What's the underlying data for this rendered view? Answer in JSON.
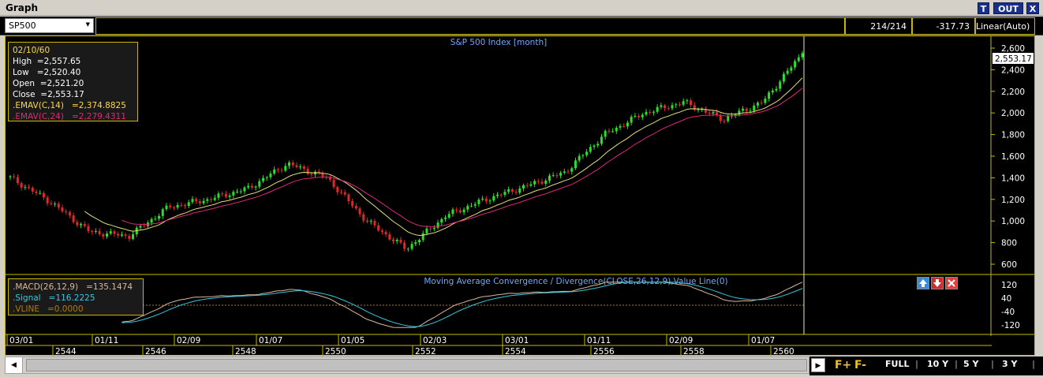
{
  "window": {
    "title": "Graph",
    "btn_t": "T",
    "btn_out": "OUT",
    "btn_x": "X"
  },
  "toolbar": {
    "symbol": "SP500",
    "bar_count": "214/214",
    "price_readout": "-317.73",
    "scale": "Linear(Auto)"
  },
  "main_chart": {
    "title": "S&P 500 Index [month]",
    "info": {
      "date": "02/10/60",
      "high": "High  =2,557.65",
      "low": "Low   =2,520.40",
      "open": "Open  =2,521.20",
      "close": "Close  =2,553.17",
      "emav14": ".EMAV(C,14)   =2,374.8825",
      "emav24": ".EMAV(C,24)   =2,279.4311"
    },
    "current_price": "2,553.17",
    "y_ticks": [
      "2,600",
      "2,400",
      "2,200",
      "2,000",
      "1,800",
      "1,600",
      "1,400",
      "1,200",
      "1,000",
      "800",
      "600"
    ]
  },
  "macd_chart": {
    "title": "Moving Average Convergence / Divergence(CLOSE,26,12,9),Value Line(0)",
    "info": {
      "macd": ".MACD(26,12,9)   =135.1474",
      "signal": ".Signal   =116.2225",
      "vline": ".VLINE   =0.0000"
    },
    "y_ticks": [
      "120",
      "40",
      "-40",
      "-120"
    ]
  },
  "x_axis": {
    "months": [
      "03/01",
      "01/11",
      "02/09",
      "01/07",
      "01/05",
      "02/03",
      "03/01",
      "01/11",
      "02/09",
      "01/07"
    ],
    "years": [
      "2544",
      "2546",
      "2548",
      "2550",
      "2552",
      "2554",
      "2556",
      "2558",
      "2560"
    ]
  },
  "bottom_bar": {
    "f_plus": "F+",
    "f_minus": "F-",
    "full": "FULL",
    "y10": "10 Y",
    "y5": "5 Y",
    "y3": "3 Y"
  },
  "chart_data": {
    "type": "candlestick",
    "title": "S&P 500 Index [month]",
    "y_range": [
      600,
      2600
    ],
    "series_close_approx": [
      {
        "x": "2544-03",
        "y": 1400
      },
      {
        "x": "2544-09",
        "y": 1180
      },
      {
        "x": "2545-06",
        "y": 900
      },
      {
        "x": "2546-03",
        "y": 860
      },
      {
        "x": "2547-01",
        "y": 1130
      },
      {
        "x": "2548-01",
        "y": 1200
      },
      {
        "x": "2549-01",
        "y": 1300
      },
      {
        "x": "2550-05",
        "y": 1530
      },
      {
        "x": "2551-01",
        "y": 1400
      },
      {
        "x": "2551-09",
        "y": 1000
      },
      {
        "x": "2552-02",
        "y": 740
      },
      {
        "x": "2552-09",
        "y": 1050
      },
      {
        "x": "2553-06",
        "y": 1200
      },
      {
        "x": "2554-03",
        "y": 1320
      },
      {
        "x": "2555-01",
        "y": 1450
      },
      {
        "x": "2556-01",
        "y": 1800
      },
      {
        "x": "2557-01",
        "y": 2000
      },
      {
        "x": "2558-04",
        "y": 2100
      },
      {
        "x": "2559-01",
        "y": 1940
      },
      {
        "x": "2559-06",
        "y": 2100
      },
      {
        "x": "2560-02",
        "y": 2553
      }
    ]
  }
}
